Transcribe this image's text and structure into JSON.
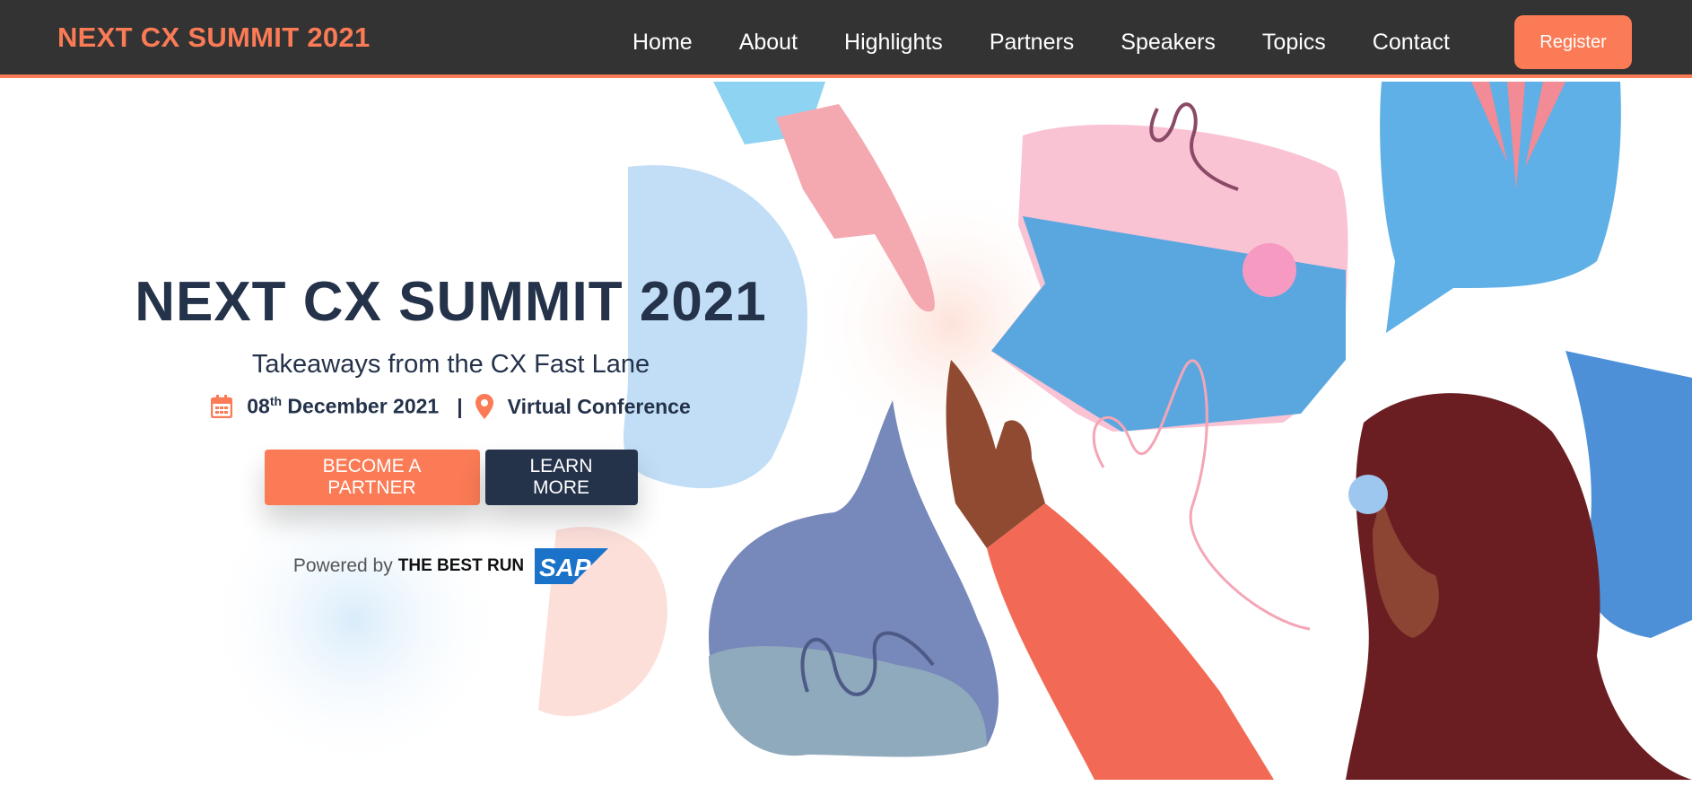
{
  "nav": {
    "brand": "NEXT CX SUMMIT 2021",
    "links": [
      "Home",
      "About",
      "Highlights",
      "Partners",
      "Speakers",
      "Topics",
      "Contact"
    ],
    "register_label": "Register"
  },
  "hero": {
    "title": "NEXT CX SUMMIT 2021",
    "subtitle": "Takeaways from the CX Fast Lane",
    "date_day": "08",
    "date_suffix": "th",
    "date_rest": " December 2021",
    "separator": "|",
    "location": "Virtual Conference",
    "partner_button": "BECOME A PARTNER",
    "learn_button": "LEARN MORE",
    "powered_by": "Powered by",
    "best_run": "THE BEST RUN",
    "sap_logo_text": "SAP"
  },
  "colors": {
    "accent": "#fa7b55",
    "navy": "#24324a",
    "navbar": "#333333"
  },
  "icons": {
    "date": "calendar-icon",
    "location": "map-pin-icon"
  }
}
